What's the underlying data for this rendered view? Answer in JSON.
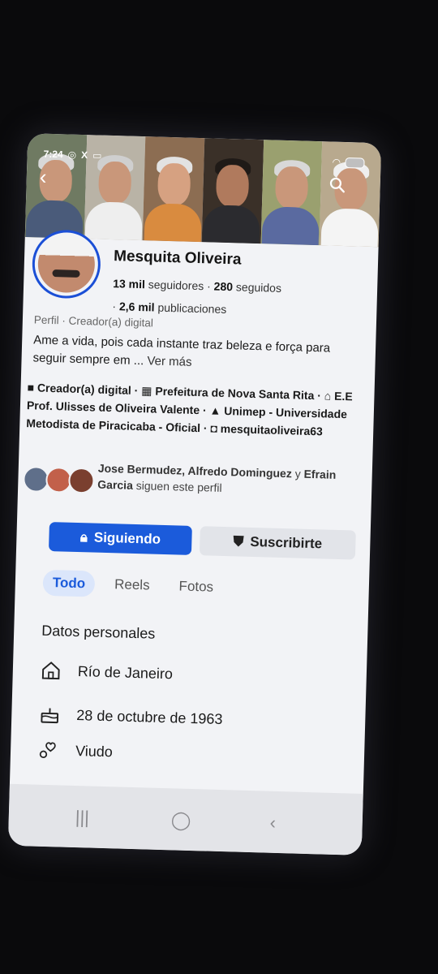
{
  "status": {
    "time": "7:24"
  },
  "profile": {
    "name": "Mesquita Oliveira",
    "followers": "13 mil",
    "followers_label": "seguidores ·",
    "following": "280",
    "following_label": "seguidos",
    "posts": "2,6 mil",
    "posts_label": "publicaciones",
    "posts_prefix": "·",
    "category": "Perfil · Creador(a) digital",
    "bio": "Ame a vida, pois cada instante traz beleza e força para seguir sempre em ...",
    "see_more": "Ver más",
    "details": [
      {
        "icon": "video-icon",
        "text": "Creador(a) digital ·"
      },
      {
        "icon": "building-icon",
        "text": "Prefeitura de Nova Santa Rita ·"
      },
      {
        "icon": "school-icon",
        "text": "E.E Prof. Ulisses de Oliveira Valente ·"
      },
      {
        "icon": "graduation-cap-icon",
        "text": "Unimep - Universidade Metodista de Piracicaba - Oficial ·"
      },
      {
        "icon": "instagram-icon",
        "text": "mesquitaoliveira63"
      }
    ]
  },
  "mutual": {
    "names": "Jose Bermudez, Alfredo Dominguez",
    "and": "y",
    "last": "Efrain Garcia",
    "suffix": "siguen este perfil"
  },
  "actions": {
    "follow_label": "Siguiendo",
    "subscribe_label": "Suscribirte"
  },
  "tabs": [
    "Todo",
    "Reels",
    "Fotos"
  ],
  "personal": {
    "title": "Datos personales",
    "location": "Río de Janeiro",
    "birthday": "28 de octubre de 1963",
    "relationship": "Viudo"
  },
  "colors": {
    "accent": "#1b5bdb",
    "background": "#f2f3f6"
  }
}
